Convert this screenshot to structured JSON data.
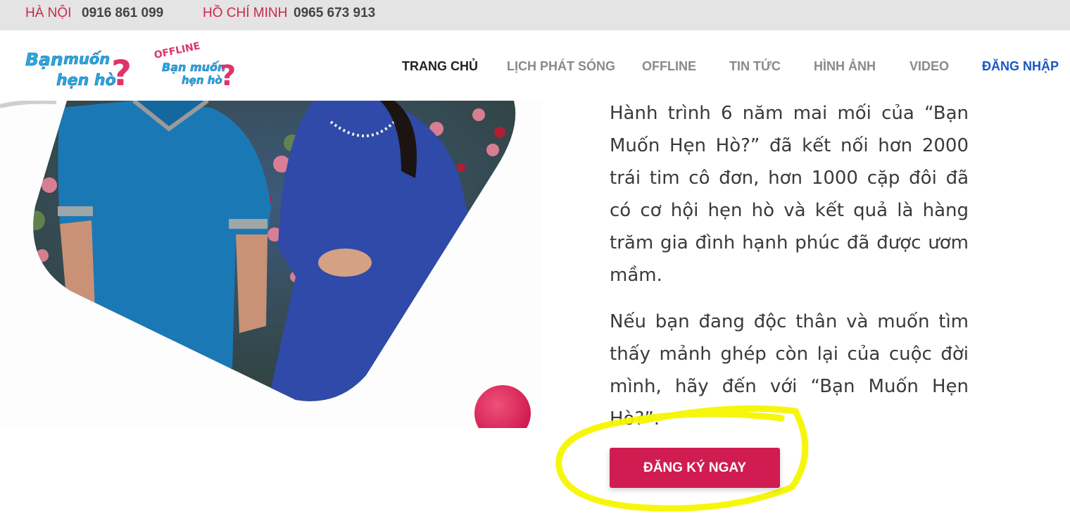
{
  "topbar": {
    "hanoi_label": "HÀ NỘI",
    "hanoi_phone": "0916 861 099",
    "hcm_label": "HỒ CHÍ MINH",
    "hcm_phone": "0965 673 913"
  },
  "logos": {
    "main_logo_text": "Bạn muốn hẹn hò?",
    "offline_logo_text": "OFFLINE Bạn muốn hẹn hò?"
  },
  "nav": {
    "items": [
      {
        "label": "TRANG CHỦ"
      },
      {
        "label": "LỊCH PHÁT SÓNG"
      },
      {
        "label": "OFFLINE"
      },
      {
        "label": "TIN TỨC"
      },
      {
        "label": "HÌNH ẢNH"
      },
      {
        "label": "VIDEO"
      },
      {
        "label": "ĐĂNG NHẬP"
      }
    ]
  },
  "content": {
    "paragraph1": "Hành trình 6 năm mai mối của “Bạn Muốn Hẹn Hò?” đã kết nối hơn 2000 trái tim cô đơn, hơn 1000 cặp đôi đã có cơ hội hẹn hò và kết quả là hàng trăm gia đình hạnh phúc đã được ươm mầm.",
    "paragraph2": "Nếu bạn đang độc thân và muốn tìm thấy mảnh ghép còn lại của cuộc đời mình, hãy đến với “Bạn Muốn Hẹn Hò?”.",
    "cta_label": "ĐĂNG KÝ NGAY"
  },
  "colors": {
    "brand_pink": "#d01c50",
    "login_blue": "#1a56c8",
    "highlight_yellow": "#f5f500"
  }
}
